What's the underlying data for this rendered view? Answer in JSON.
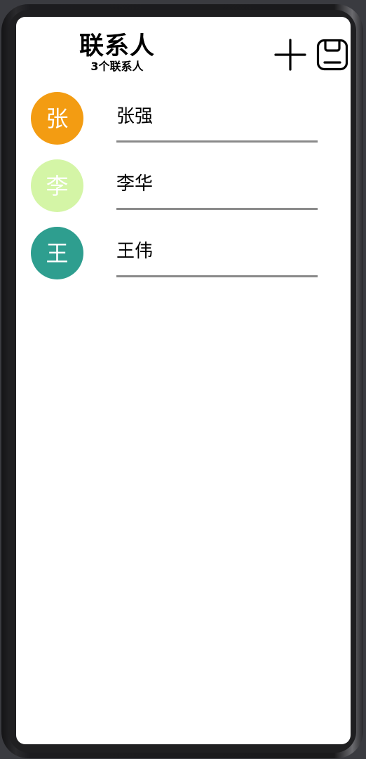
{
  "header": {
    "title": "联系人",
    "subtitle": "3个联系人",
    "add_icon": "plus-icon",
    "save_icon": "save-icon"
  },
  "contacts": [
    {
      "initial": "张",
      "name": "张强",
      "avatar_color": "#F39C12"
    },
    {
      "initial": "李",
      "name": "李华",
      "avatar_color": "#D4F5A6"
    },
    {
      "initial": "王",
      "name": "王伟",
      "avatar_color": "#2E9E8F"
    }
  ]
}
